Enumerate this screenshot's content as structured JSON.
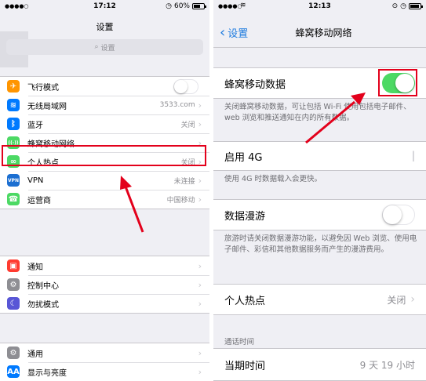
{
  "left": {
    "status": {
      "time": "17:12",
      "battery": "60%",
      "battery_level": 0.6
    },
    "nav_title": "设置",
    "search": {
      "placeholder": "设置"
    },
    "group1": [
      {
        "icon": "airplane-icon",
        "color": "#ff9500",
        "glyph": "✈",
        "label": "飞行模式",
        "value": "",
        "control": "toggle-off"
      },
      {
        "icon": "wifi-icon",
        "color": "#007aff",
        "glyph": "≋",
        "label": "无线局域网",
        "value": "3533.com",
        "control": "chevron"
      },
      {
        "icon": "bluetooth-icon",
        "color": "#007aff",
        "glyph": "ᛒ",
        "label": "蓝牙",
        "value": "关闭",
        "control": "chevron"
      },
      {
        "icon": "cellular-icon",
        "color": "#4cd964",
        "glyph": "((·))",
        "label": "蜂窝移动网络",
        "value": "",
        "control": "chevron"
      },
      {
        "icon": "hotspot-icon",
        "color": "#4cd964",
        "glyph": "∞",
        "label": "个人热点",
        "value": "关闭",
        "control": "chevron"
      },
      {
        "icon": "vpn-icon",
        "color": "#1c6fd1",
        "glyph": "VPN",
        "label": "VPN",
        "value": "未连接",
        "control": "chevron"
      },
      {
        "icon": "carrier-icon",
        "color": "#4cd964",
        "glyph": "☎",
        "label": "运营商",
        "value": "中国移动",
        "control": "chevron"
      }
    ],
    "group2": [
      {
        "icon": "notifications-icon",
        "color": "#ff3b30",
        "glyph": "▣",
        "label": "通知"
      },
      {
        "icon": "control-center-icon",
        "color": "#8e8e93",
        "glyph": "⚙",
        "label": "控制中心"
      },
      {
        "icon": "do-not-disturb-icon",
        "color": "#5856d6",
        "glyph": "☾",
        "label": "勿扰模式"
      }
    ],
    "group3": [
      {
        "icon": "general-icon",
        "color": "#8e8e93",
        "glyph": "⚙",
        "label": "通用"
      },
      {
        "icon": "display-icon",
        "color": "#007aff",
        "glyph": "AA",
        "label": "显示与亮度"
      }
    ]
  },
  "right": {
    "status": {
      "time": "12:13"
    },
    "back_label": "设置",
    "nav_title": "蜂窝移动网络",
    "cellular_data": {
      "label": "蜂窝移动数据",
      "on": true
    },
    "cellular_footer": "关闭蜂窝移动数据，可让包括 Wi-Fi 使用包括电子邮件、web 浏览和推送通知在内的所有数据。",
    "enable_4g": {
      "label": "启用 4G"
    },
    "enable_4g_footer": "使用 4G 时数据载入会更快。",
    "roaming": {
      "label": "数据漫游",
      "on": false
    },
    "roaming_footer": "旅游时请关闭数据漫游功能，以避免因 Web 浏览、使用电子邮件、彩信和其他数据服务而产生的漫游费用。",
    "hotspot": {
      "label": "个人热点",
      "value": "关闭"
    },
    "call_time_header": "通话时间",
    "current_period": {
      "label": "当期时间",
      "value": "9 天 19 小时"
    }
  },
  "colors": {
    "highlight": "#e3001b",
    "toggle_on": "#4cd964",
    "link": "#1e7bdf"
  }
}
